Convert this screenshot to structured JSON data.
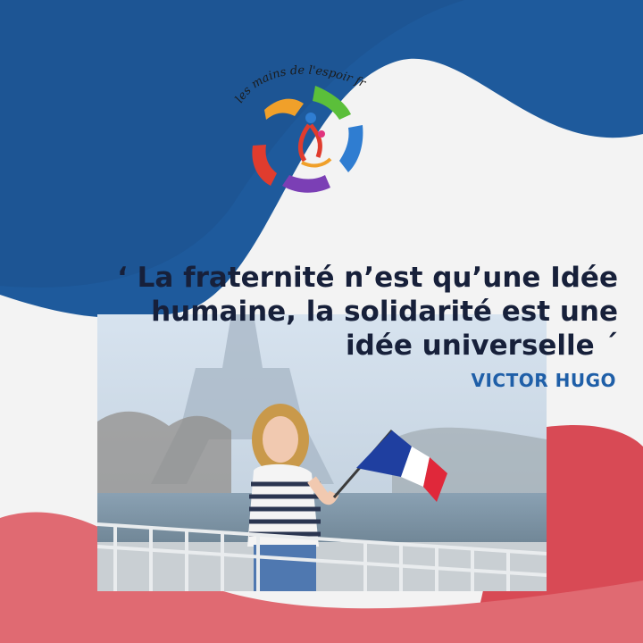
{
  "brand": {
    "logo_text": "les mains de l'espoir français",
    "logo_icon": "hands-circle-logo",
    "colors": {
      "blue": "#1e5a9c",
      "red": "#d84a55",
      "orange": "#f0a02a",
      "green": "#5bbf3a",
      "purple": "#7b3fb5"
    }
  },
  "quote": {
    "line1": "‘ La fraternité n’est qu’une Idée",
    "line2": "humaine, la solidarité est une",
    "line3": "idée universelle ´",
    "author": "VICTOR HUGO"
  },
  "photo": {
    "subject": "woman-with-french-flag-photo",
    "flag_colors": [
      "#1f3fa0",
      "#ffffff",
      "#e0283a"
    ]
  }
}
